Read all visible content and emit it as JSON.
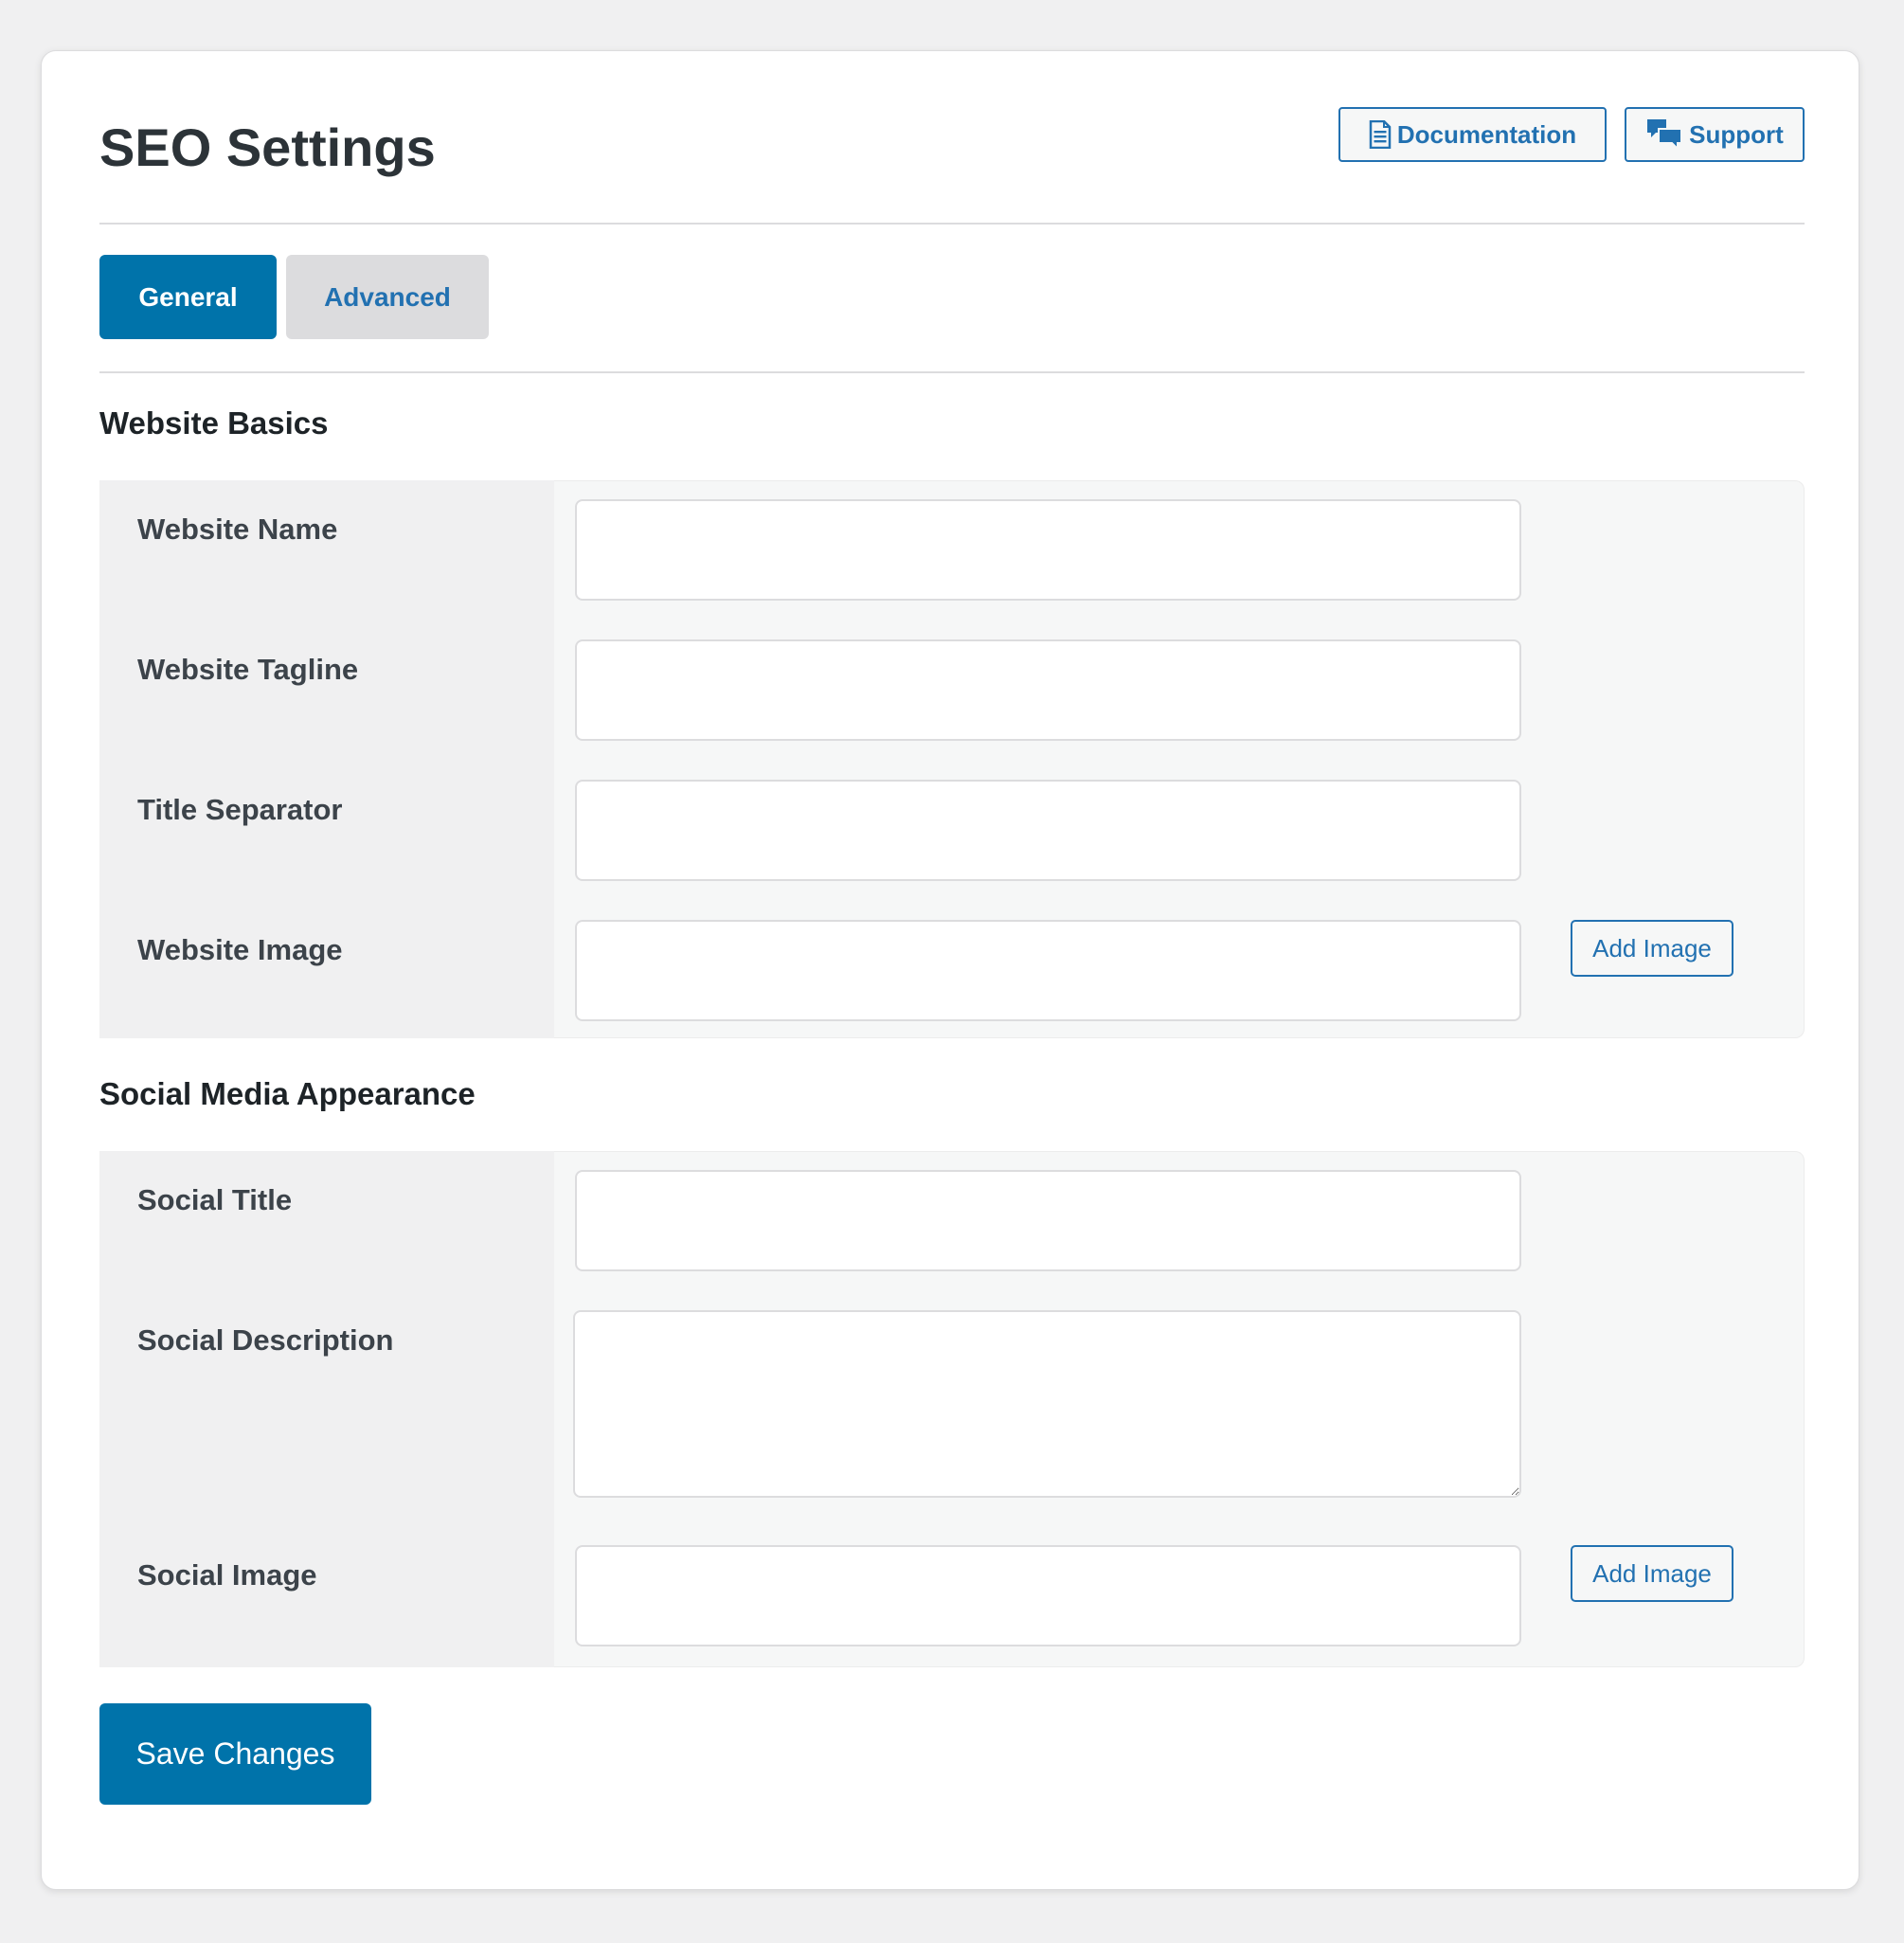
{
  "page": {
    "title": "SEO Settings"
  },
  "header_buttons": {
    "documentation": {
      "label": "Documentation",
      "icon": "document-icon"
    },
    "support": {
      "label": "Support",
      "icon": "speech-bubbles-icon"
    }
  },
  "tabs": [
    {
      "label": "General",
      "active": true
    },
    {
      "label": "Advanced",
      "active": false
    }
  ],
  "sections": [
    {
      "heading": "Website Basics",
      "fields": [
        {
          "label": "Website Name",
          "value": "",
          "type": "text"
        },
        {
          "label": "Website Tagline",
          "value": "",
          "type": "text"
        },
        {
          "label": "Title Separator",
          "value": "",
          "type": "text"
        },
        {
          "label": "Website Image",
          "value": "",
          "type": "image",
          "button_label": "Add Image"
        }
      ]
    },
    {
      "heading": "Social Media Appearance",
      "fields": [
        {
          "label": "Social Title",
          "value": "",
          "type": "text"
        },
        {
          "label": "Social Description",
          "value": "",
          "type": "textarea"
        },
        {
          "label": "Social Image",
          "value": "",
          "type": "image",
          "button_label": "Add Image"
        }
      ]
    }
  ],
  "footer": {
    "save_label": "Save Changes"
  },
  "colors": {
    "primary": "#0073aa",
    "link": "#2271b1",
    "background": "#f0f0f1",
    "card": "#ffffff",
    "label_column": "#f0f0f1",
    "field_column": "#f6f7f7"
  }
}
